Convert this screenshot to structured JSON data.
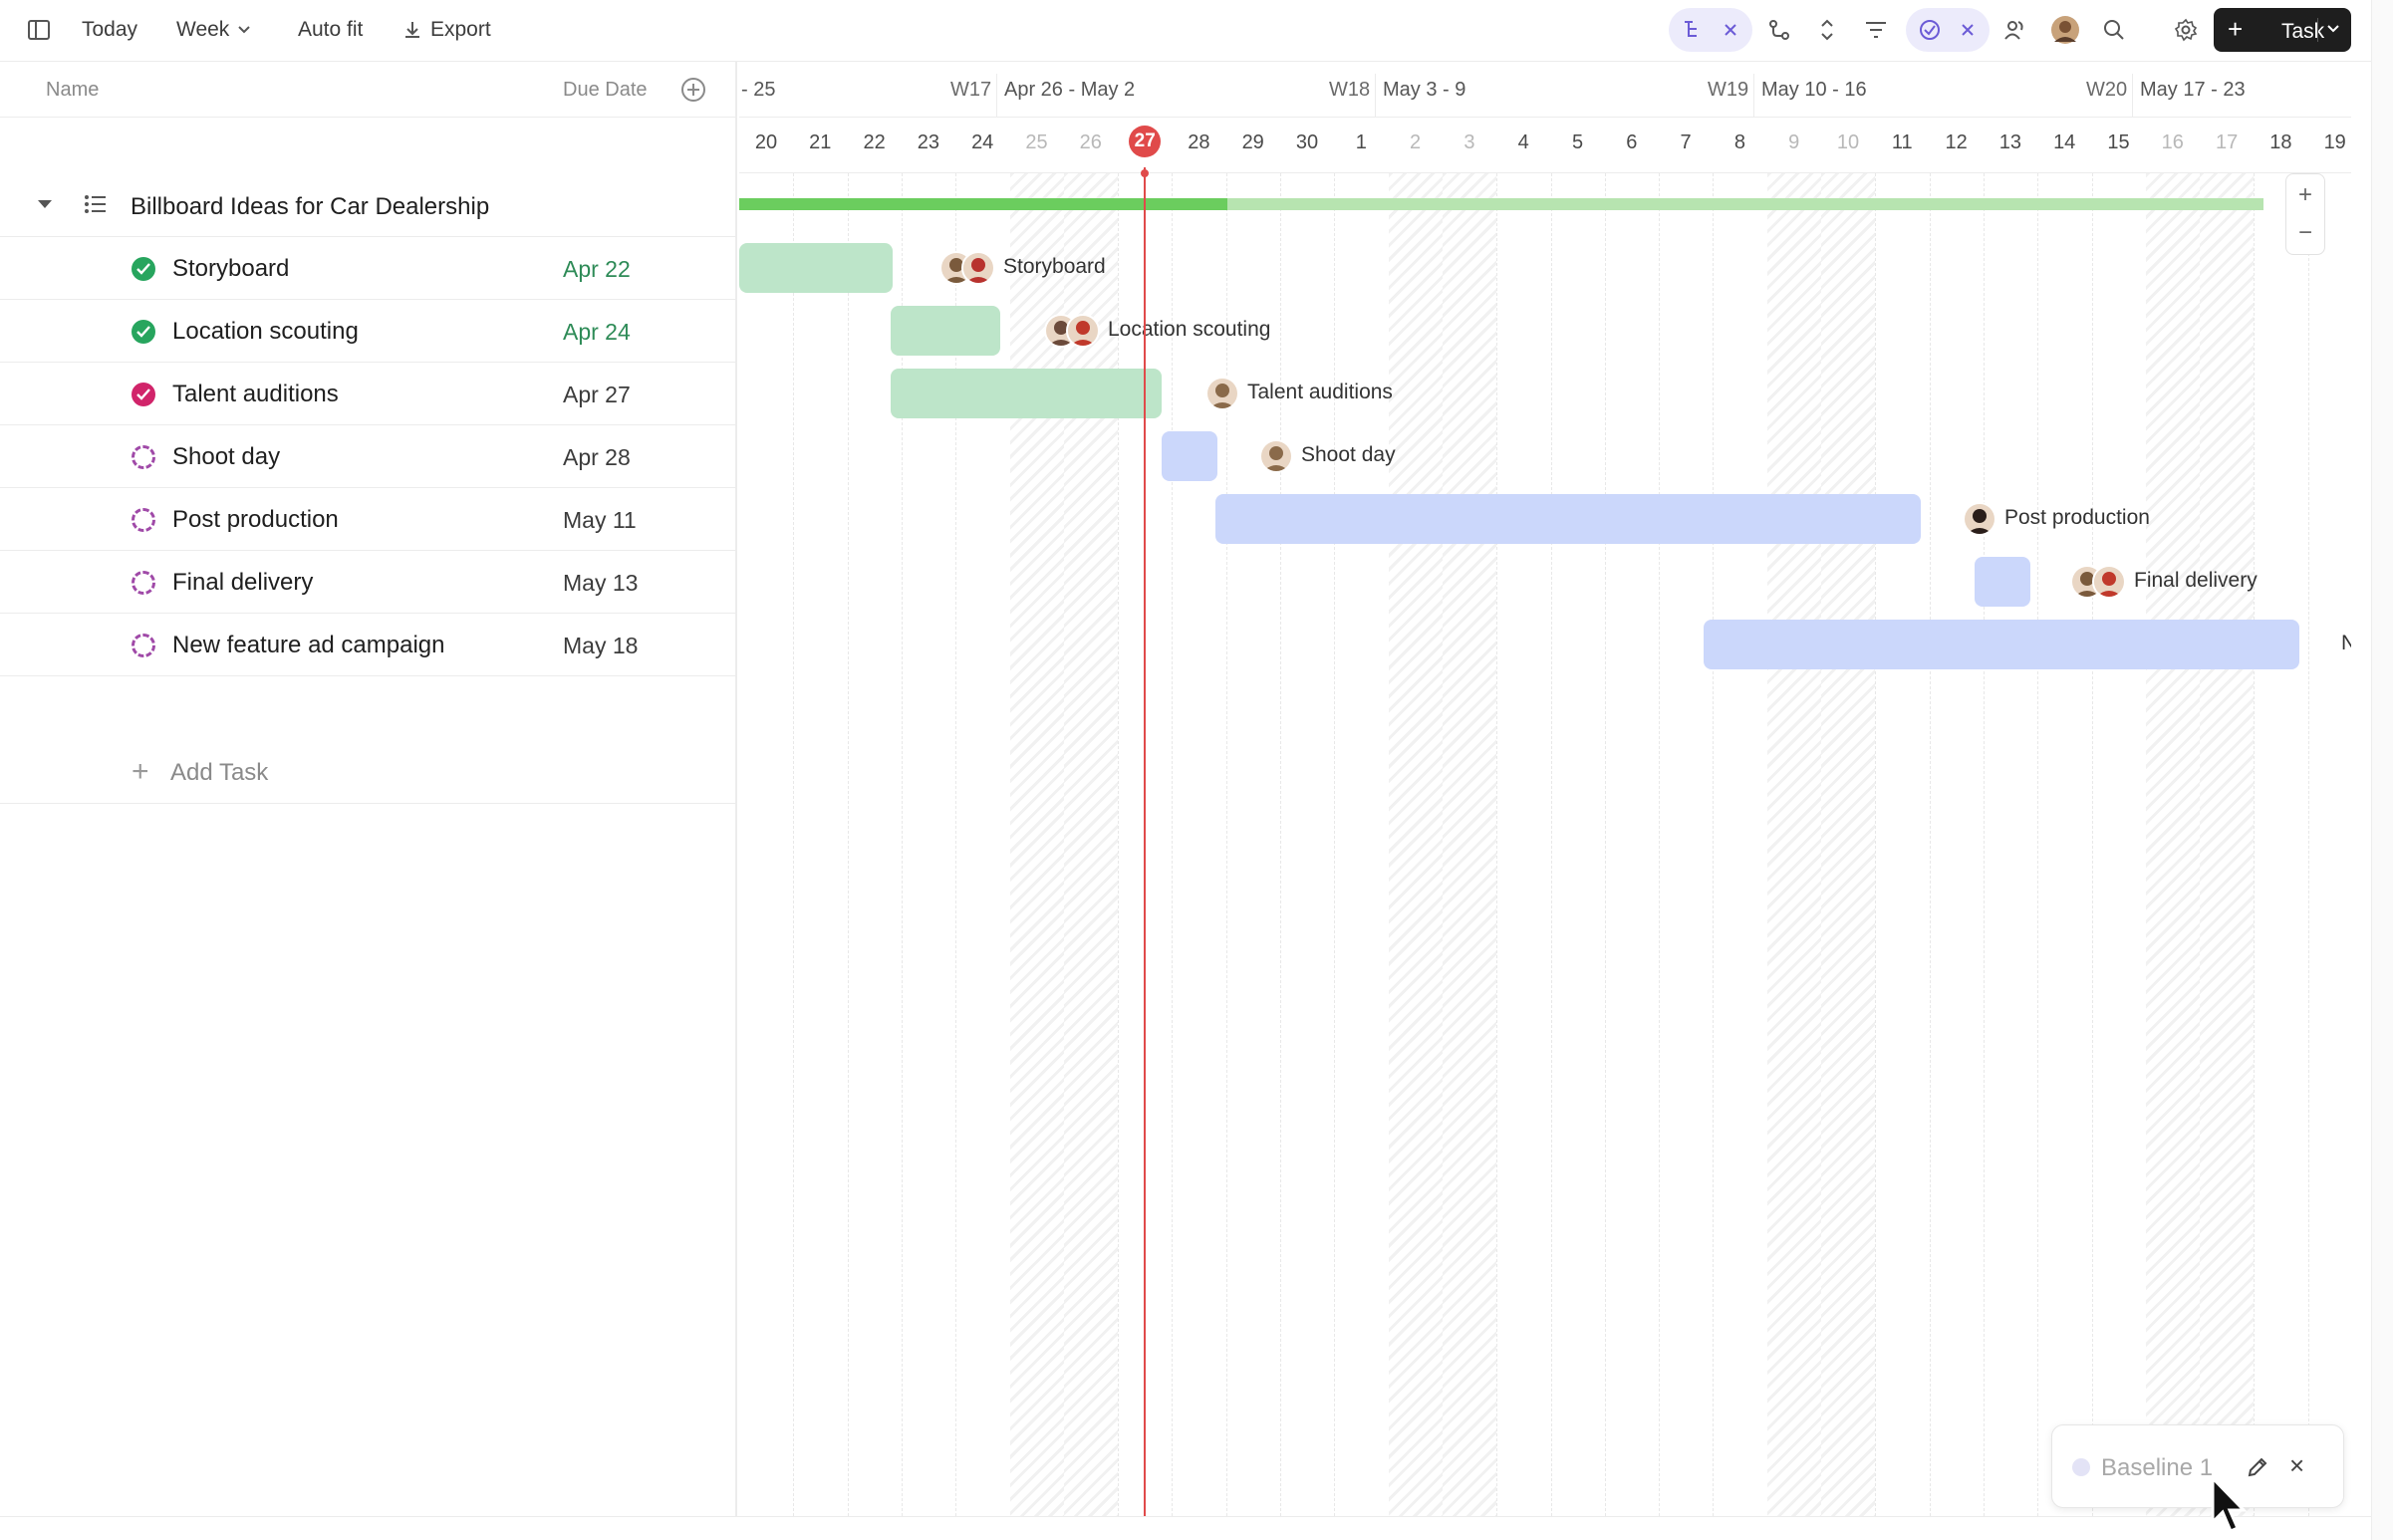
{
  "toolbar": {
    "today_label": "Today",
    "week_label": "Week",
    "autofit_label": "Auto fit",
    "export_label": "Export",
    "task_button_label": "Task",
    "icons": [
      "sidebar-toggle-icon",
      "subtasks-filter-icon",
      "dependency-icon",
      "expand-collapse-icon",
      "filter-icon",
      "closed-tasks-icon",
      "assignees-icon",
      "avatar-icon",
      "search-icon",
      "settings-icon"
    ]
  },
  "left_pane": {
    "col_name": "Name",
    "col_due": "Due Date",
    "group_title": "Billboard Ideas for Car Dealership",
    "tasks": [
      {
        "name": "Storyboard",
        "due": "Apr 22",
        "status": "done"
      },
      {
        "name": "Location scouting",
        "due": "Apr 24",
        "status": "done"
      },
      {
        "name": "Talent auditions",
        "due": "Apr 27",
        "status": "review"
      },
      {
        "name": "Shoot day",
        "due": "Apr 28",
        "status": "todo"
      },
      {
        "name": "Post production",
        "due": "May 11",
        "status": "todo"
      },
      {
        "name": "Final delivery",
        "due": "May 13",
        "status": "todo"
      },
      {
        "name": "New feature ad campaign",
        "due": "May 18",
        "status": "todo"
      }
    ],
    "add_task_label": "Add Task"
  },
  "timeline": {
    "weeks": [
      {
        "label": "- 25",
        "num": ""
      },
      {
        "label": "Apr 26 - May 2",
        "num": "W17"
      },
      {
        "label": "May 3 - 9",
        "num": "W18"
      },
      {
        "label": "May 10 - 16",
        "num": "W19"
      },
      {
        "label": "May 17 - 23",
        "num": "W20"
      }
    ],
    "days": [
      {
        "d": "20",
        "weekend": false
      },
      {
        "d": "21",
        "weekend": false
      },
      {
        "d": "22",
        "weekend": false
      },
      {
        "d": "23",
        "weekend": false
      },
      {
        "d": "24",
        "weekend": false
      },
      {
        "d": "25",
        "weekend": true
      },
      {
        "d": "26",
        "weekend": true
      },
      {
        "d": "27",
        "weekend": false,
        "today": true
      },
      {
        "d": "28",
        "weekend": false
      },
      {
        "d": "29",
        "weekend": false
      },
      {
        "d": "30",
        "weekend": false
      },
      {
        "d": "1",
        "weekend": false
      },
      {
        "d": "2",
        "weekend": true
      },
      {
        "d": "3",
        "weekend": true
      },
      {
        "d": "4",
        "weekend": false
      },
      {
        "d": "5",
        "weekend": false
      },
      {
        "d": "6",
        "weekend": false
      },
      {
        "d": "7",
        "weekend": false
      },
      {
        "d": "8",
        "weekend": false
      },
      {
        "d": "9",
        "weekend": true
      },
      {
        "d": "10",
        "weekend": true
      },
      {
        "d": "11",
        "weekend": false
      },
      {
        "d": "12",
        "weekend": false
      },
      {
        "d": "13",
        "weekend": false
      },
      {
        "d": "14",
        "weekend": false
      },
      {
        "d": "15",
        "weekend": false
      },
      {
        "d": "16",
        "weekend": true
      },
      {
        "d": "17",
        "weekend": true
      },
      {
        "d": "18",
        "weekend": false
      },
      {
        "d": "19",
        "weekend": false
      }
    ],
    "group_progress_pct": 32,
    "bars": [
      {
        "label": "Storyboard",
        "status": "done",
        "avatars": [
          "#7a5a3c",
          "#b8322e"
        ]
      },
      {
        "label": "Location scouting",
        "status": "done",
        "avatars": [
          "#6b4a3a",
          "#c0392b"
        ]
      },
      {
        "label": "Talent auditions",
        "status": "done",
        "avatars": [
          "#8a6a4a"
        ]
      },
      {
        "label": "Shoot day",
        "status": "todo",
        "avatars": [
          "#8a6a4a"
        ]
      },
      {
        "label": "Post production",
        "status": "todo",
        "avatars": [
          "#2a1e1a"
        ]
      },
      {
        "label": "Final delivery",
        "status": "todo",
        "avatars": [
          "#7a5a3c",
          "#c0392b"
        ]
      },
      {
        "label": "Ne",
        "status": "todo",
        "avatars": []
      }
    ],
    "zoom_in": "+",
    "zoom_out": "−"
  },
  "baseline": {
    "label": "Baseline 1",
    "close": "×"
  },
  "colors": {
    "today_red": "#e04a4a",
    "done_bar": "#bde5c9",
    "todo_bar": "#cbd7fb",
    "progress_green": "#6bcd5e"
  }
}
